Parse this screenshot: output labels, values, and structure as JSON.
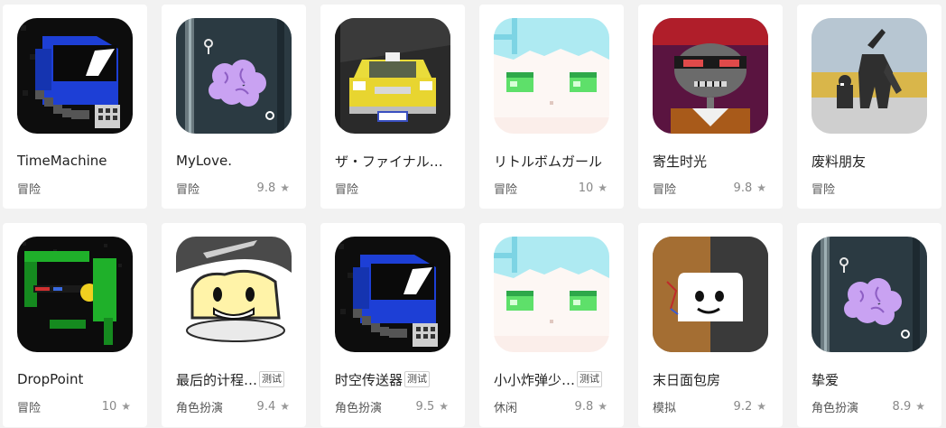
{
  "games": [
    {
      "title": "TimeMachine",
      "genre": "冒险",
      "score": "",
      "badge": "",
      "icon": "astronaut-icon"
    },
    {
      "title": "MyLove.",
      "genre": "冒险",
      "score": "9.8",
      "badge": "",
      "icon": "brain-icon"
    },
    {
      "title": "ザ・ファイナル…",
      "genre": "冒险",
      "score": "",
      "badge": "",
      "icon": "taxi-icon"
    },
    {
      "title": "リトルボムガール",
      "genre": "冒险",
      "score": "10",
      "badge": "",
      "icon": "anime-girl-icon"
    },
    {
      "title": "寄生时光",
      "genre": "冒险",
      "score": "9.8",
      "badge": "",
      "icon": "skull-girl-icon"
    },
    {
      "title": "废料朋友",
      "genre": "冒险",
      "score": "",
      "badge": "",
      "icon": "scrap-robot-icon"
    },
    {
      "title": "DropPoint",
      "genre": "冒险",
      "score": "10",
      "badge": "",
      "icon": "green-robot-icon"
    },
    {
      "title": "最后的计程…",
      "genre": "角色扮演",
      "score": "9.4",
      "badge": "测试",
      "icon": "smiling-blob-icon"
    },
    {
      "title": "时空传送器",
      "genre": "角色扮演",
      "score": "9.5",
      "badge": "测试",
      "icon": "astronaut-icon"
    },
    {
      "title": "小小炸弹少…",
      "genre": "休闲",
      "score": "9.8",
      "badge": "测试",
      "icon": "anime-girl-icon"
    },
    {
      "title": "末日面包房",
      "genre": "模拟",
      "score": "9.2",
      "badge": "",
      "icon": "toast-icon"
    },
    {
      "title": "挚爱",
      "genre": "角色扮演",
      "score": "8.9",
      "badge": "",
      "icon": "brain-icon"
    }
  ]
}
